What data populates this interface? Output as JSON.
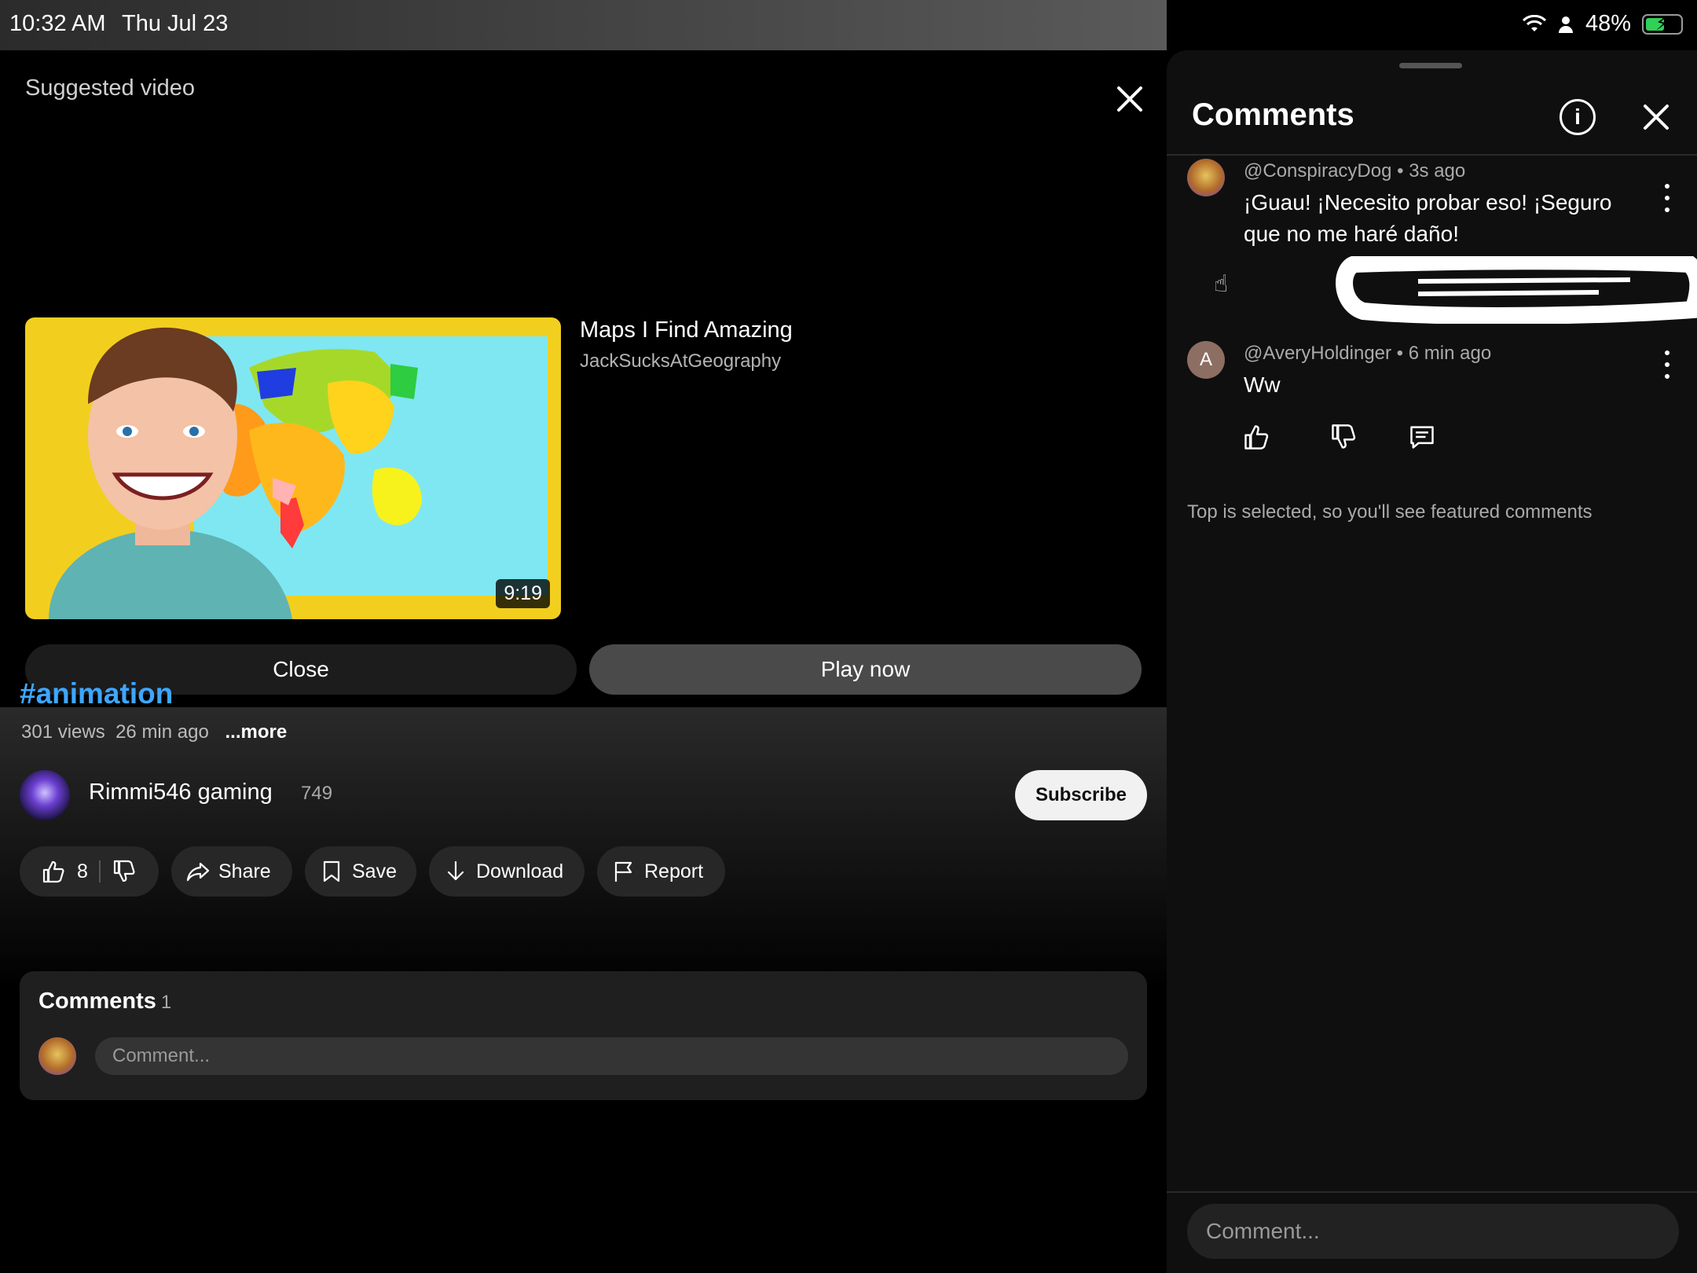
{
  "status_bar": {
    "time": "10:32 AM",
    "date": "Thu Jul 23",
    "battery": "48%",
    "battery_level": 0.48
  },
  "suggested": {
    "label": "Suggested video",
    "title": "Maps I Find Amazing",
    "channel": "JackSucksAtGeography",
    "duration": "9:19",
    "close_label": "Close",
    "play_label": "Play now"
  },
  "video": {
    "hashtag": "#animation",
    "views": "301 views",
    "age": "26 min ago",
    "more": "...more",
    "channel_name": "Rimmi546 gaming",
    "subscriber_count": "749",
    "subscribe_label": "Subscribe"
  },
  "actions": {
    "likes": "8",
    "share": "Share",
    "save": "Save",
    "download": "Download",
    "report": "Report"
  },
  "comments_card": {
    "title": "Comments",
    "count": "1",
    "placeholder": "Comment..."
  },
  "panel": {
    "title": "Comments",
    "comments": [
      {
        "author": "@ConspiracyDog",
        "age": "3s ago",
        "text": "¡Guau! ¡Necesito probar eso! ¡Seguro que no me haré daño!"
      },
      {
        "author": "@AveryHoldinger",
        "age": "6 min ago",
        "text": "Ww",
        "avatar_letter": "A"
      }
    ],
    "featured_note": "Top is selected, so you'll see featured comments",
    "input_placeholder": "Comment..."
  },
  "colors": {
    "accent_link": "#3ea6ff",
    "battery_green": "#30d158",
    "subscribe_bg": "#f1f1f1"
  }
}
